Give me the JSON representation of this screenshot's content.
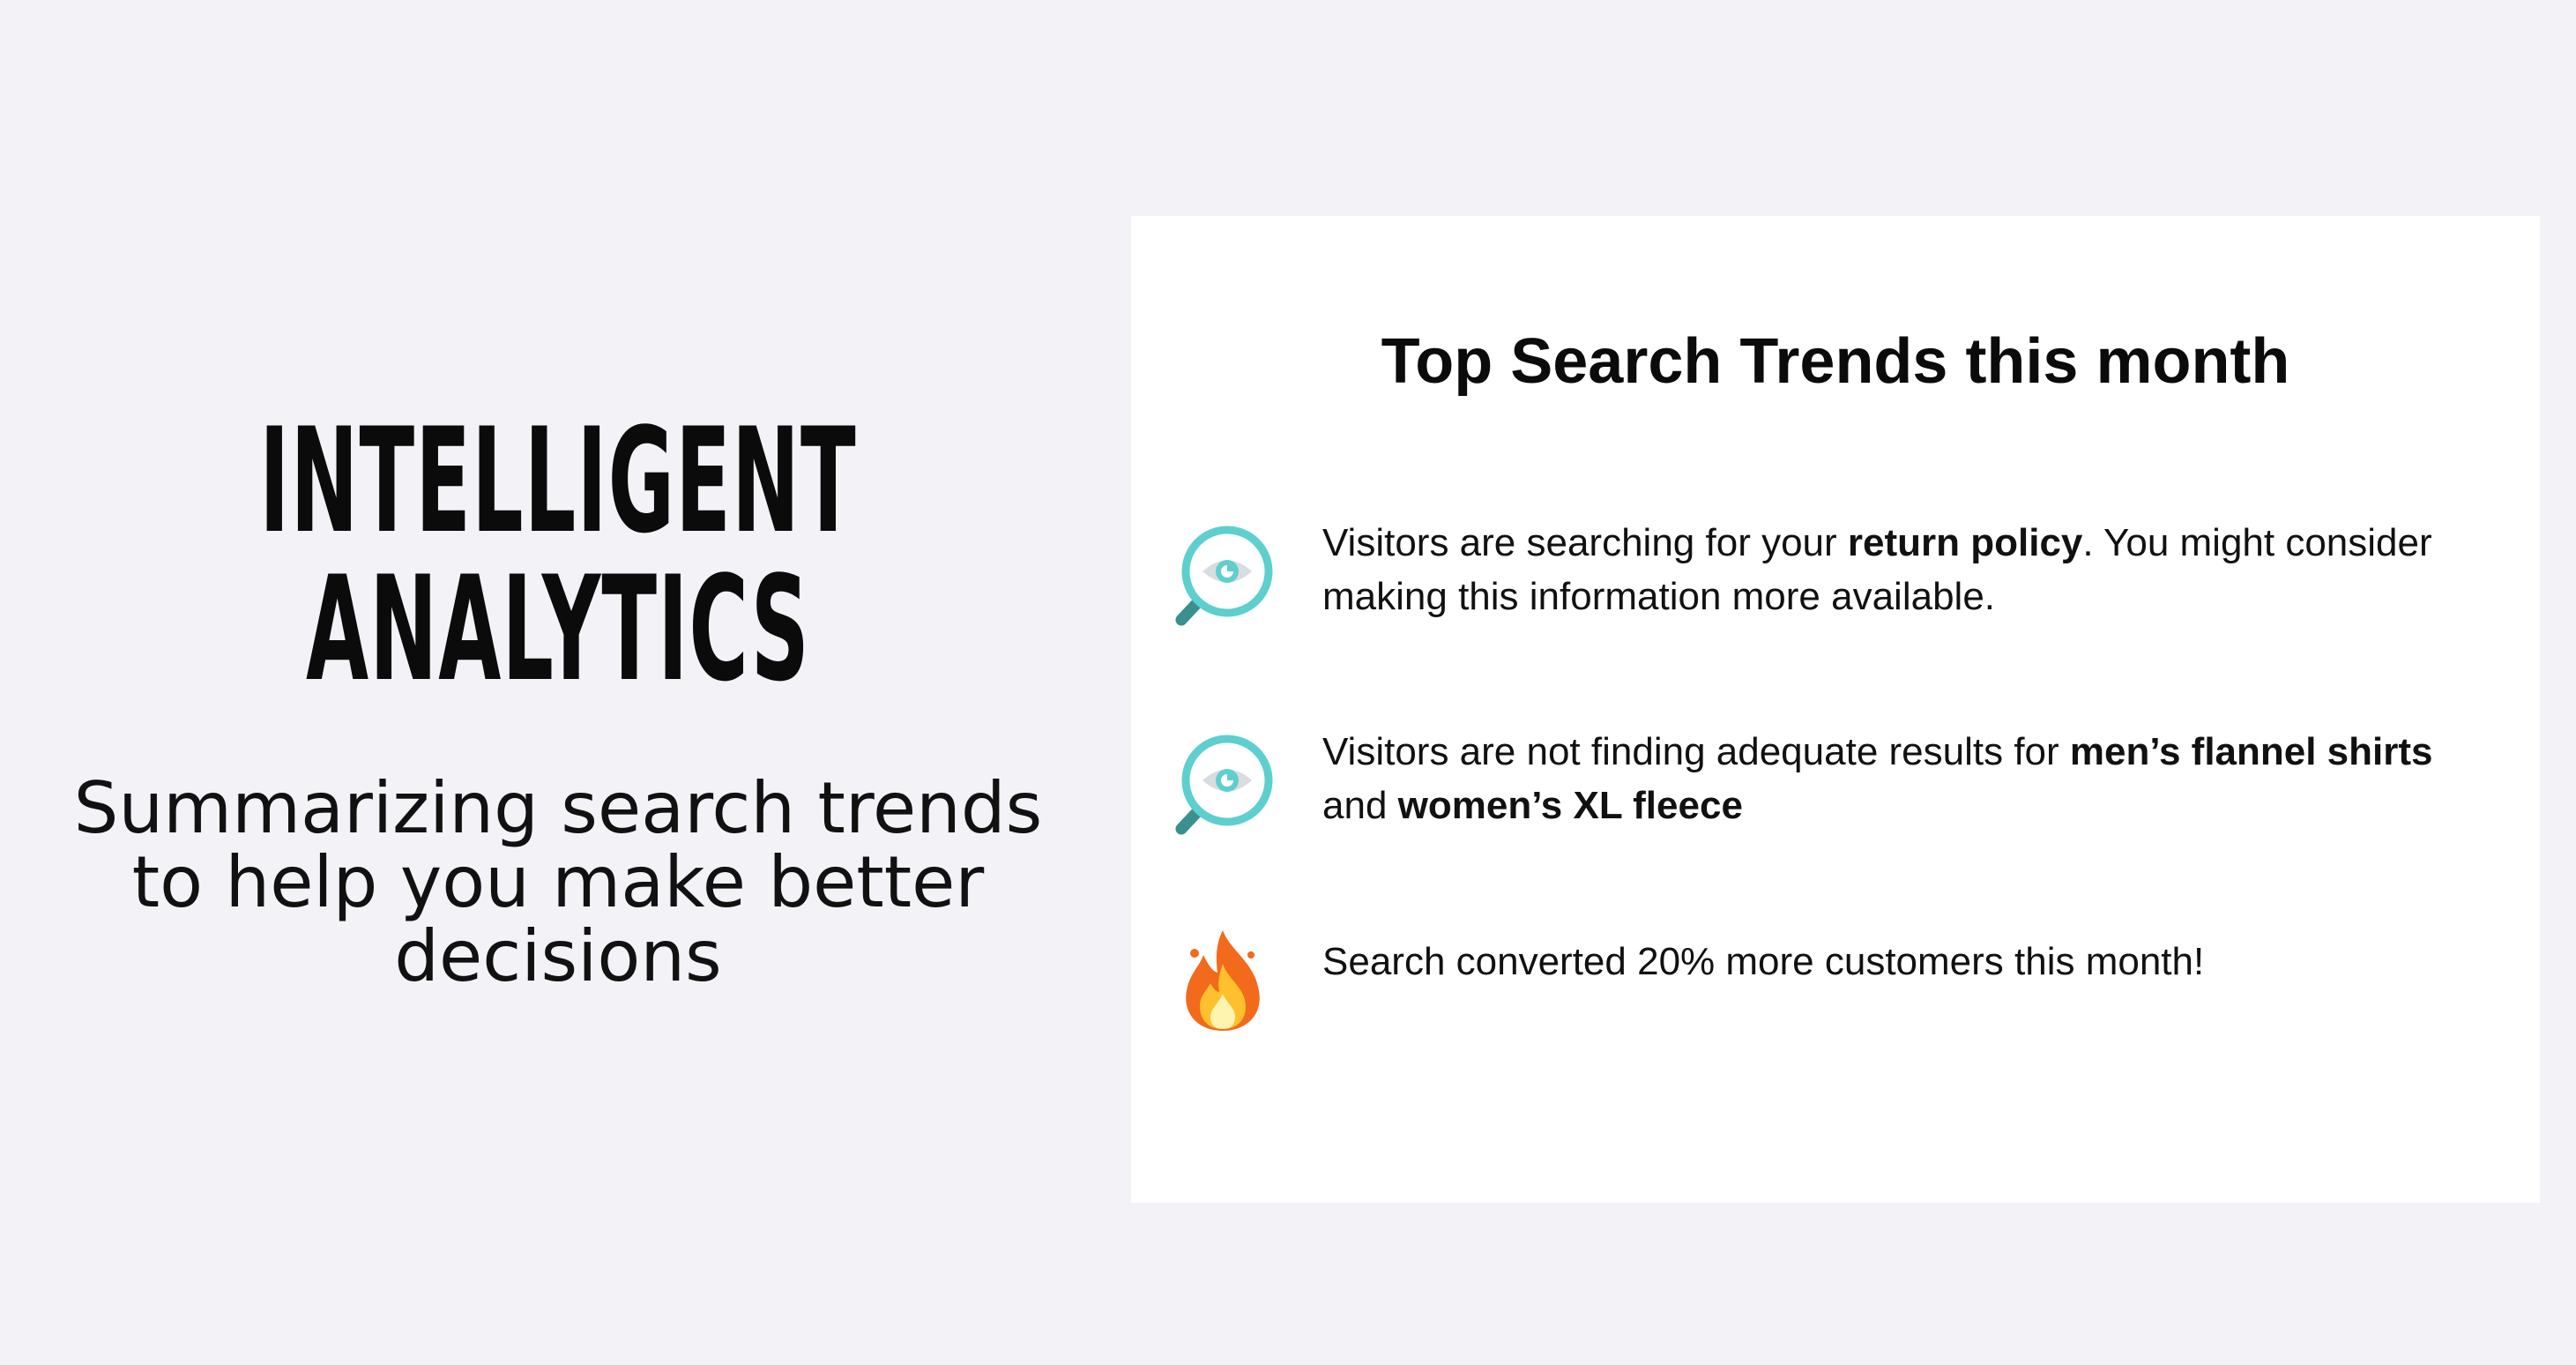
{
  "hero": {
    "title_line1": "INTELLIGENT",
    "title_line2": "ANALYTICS",
    "subtitle": "Summarizing search trends to help you make better decisions"
  },
  "card": {
    "title": "Top Search Trends this month",
    "items": [
      {
        "icon": "magnifier-eye-icon",
        "text_a": "Visitors are searching for your ",
        "bold_a": "return policy",
        "text_b": ". You might consider making this information more available."
      },
      {
        "icon": "magnifier-eye-icon",
        "text_a": "Visitors are not finding adequate results for ",
        "bold_a": "men’s flannel shirts",
        "text_b": " and ",
        "bold_b": "women’s XL fleece"
      },
      {
        "icon": "fire-icon",
        "text_a": "Search converted 20% more customers this month!"
      }
    ]
  },
  "colors": {
    "background": "#f3f2f7",
    "card": "#ffffff",
    "accent_teal": "#5ecfcf",
    "handle_teal": "#3a8f8f",
    "fire_orange": "#f26a1b"
  }
}
